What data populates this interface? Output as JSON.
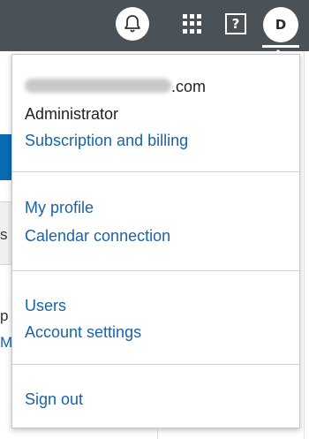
{
  "topbar": {
    "bell_icon": "bell-icon",
    "apps_icon": "apps-grid-icon",
    "help_label": "?",
    "avatar_initial": "D"
  },
  "background": {
    "left_char_1": "s",
    "left_char_2": "p",
    "left_char_3": "M"
  },
  "account_menu": {
    "email_domain": ".com",
    "role": "Administrator",
    "subscription": "Subscription and billing",
    "my_profile": "My profile",
    "calendar": "Calendar connection",
    "users": "Users",
    "account_settings": "Account settings",
    "sign_out": "Sign out"
  },
  "colors": {
    "topbar": "#4a5157",
    "link": "#1a63a8",
    "accent_blue": "#0a6ab3"
  }
}
